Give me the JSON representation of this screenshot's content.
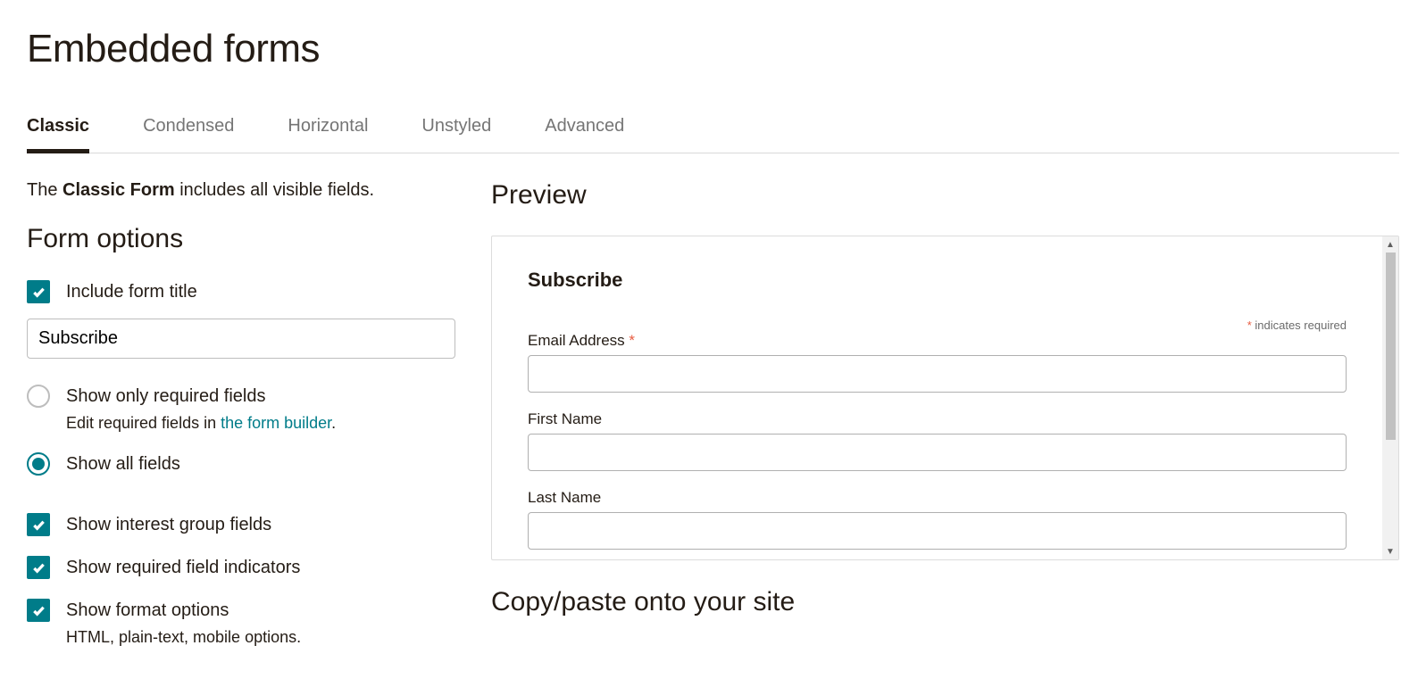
{
  "page_title": "Embedded forms",
  "tabs": [
    "Classic",
    "Condensed",
    "Horizontal",
    "Unstyled",
    "Advanced"
  ],
  "active_tab": 0,
  "intro_prefix": "The ",
  "intro_bold": "Classic Form",
  "intro_suffix": " includes all visible fields.",
  "form_options_heading": "Form options",
  "options": {
    "include_title_label": "Include form title",
    "title_value": "Subscribe",
    "show_required_label": "Show only required fields",
    "show_required_sub_prefix": "Edit required fields in ",
    "show_required_link": "the form builder",
    "show_required_sub_suffix": ".",
    "show_all_label": "Show all fields",
    "show_interest_label": "Show interest group fields",
    "show_indicators_label": "Show required field indicators",
    "show_format_label": "Show format options",
    "show_format_sub": "HTML, plain-text, mobile options."
  },
  "preview": {
    "heading": "Preview",
    "form_title": "Subscribe",
    "required_text": " indicates required",
    "asterisk": "*",
    "fields": {
      "email_label": "Email Address ",
      "first_name_label": "First Name",
      "last_name_label": "Last Name"
    }
  },
  "copy_heading": "Copy/paste onto your site"
}
